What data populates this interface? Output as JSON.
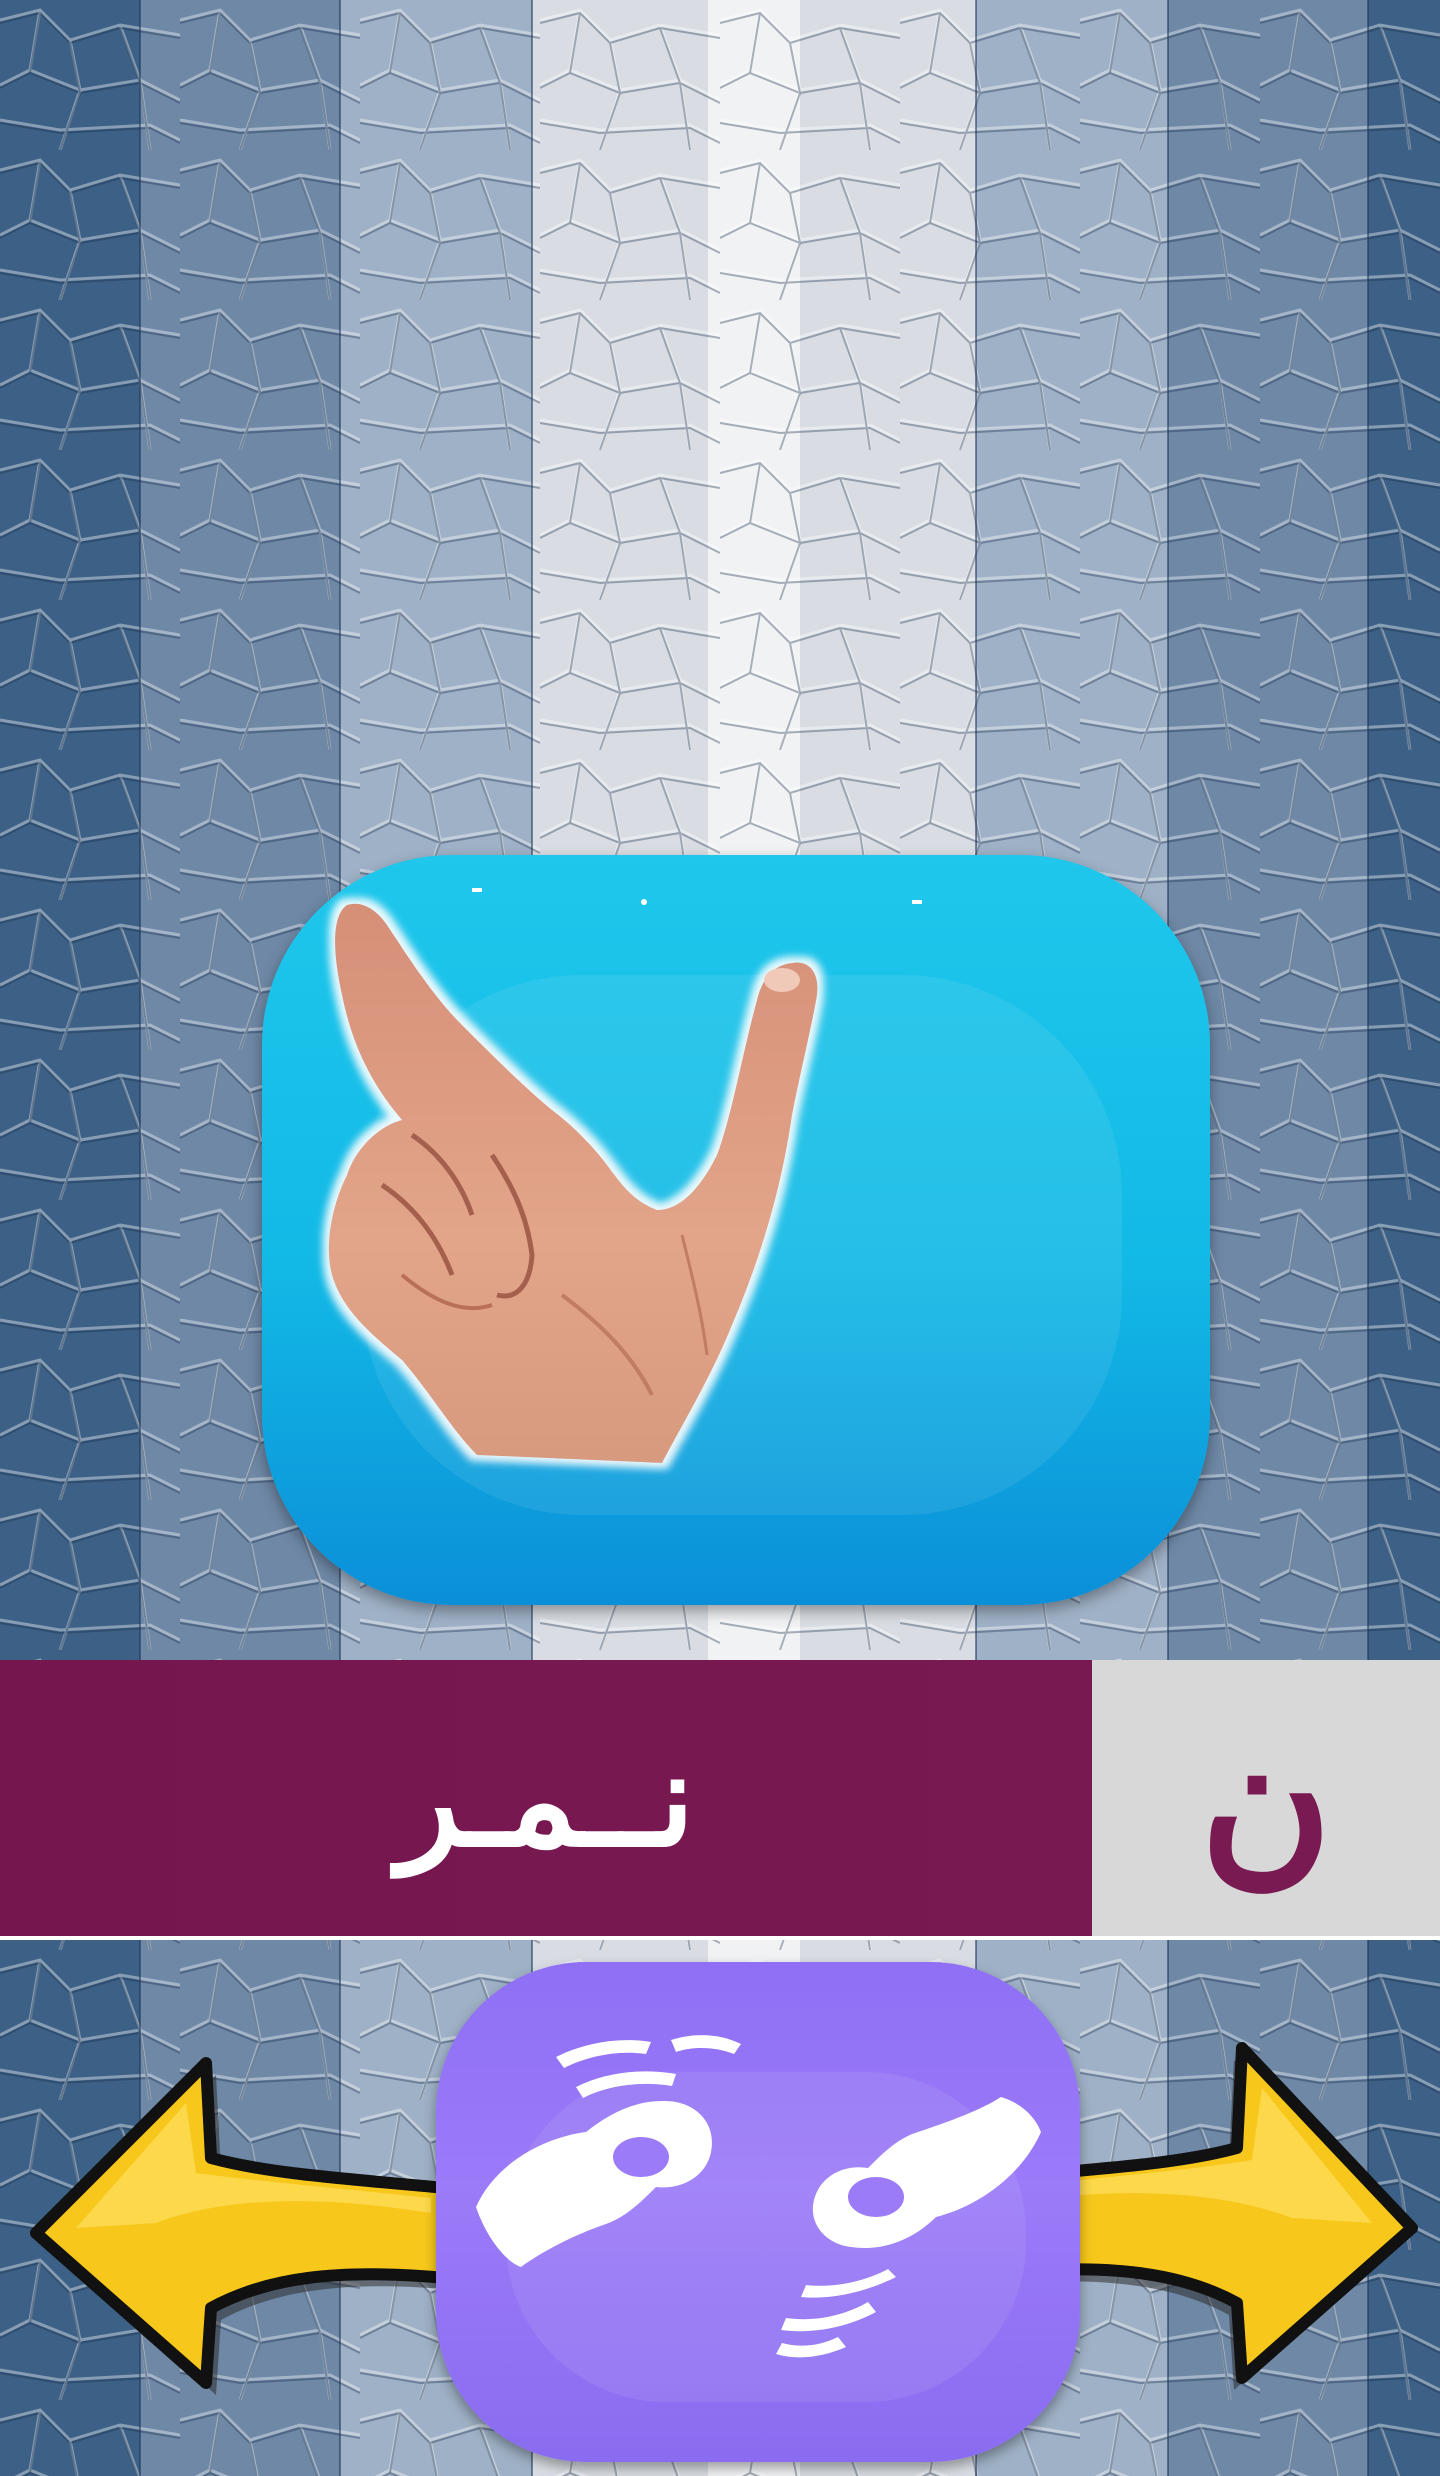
{
  "lesson": {
    "word": "نــمـر",
    "letter": "ن"
  },
  "sign_image": {
    "icon": "hand-sign-letter-noon-icon",
    "card_color": "#12b9e6"
  },
  "controls": {
    "previous_icon": "arrow-left-icon",
    "next_icon": "arrow-right-icon",
    "center_icon": "sign-language-hands-icon",
    "center_color": "#9b7bf8",
    "arrow_color": "#f7c81b"
  },
  "colors": {
    "banner": "#7a1a53",
    "letter_box": "#d8d8d8",
    "word_text": "#ffffff",
    "letter_text": "#7a1a53"
  }
}
